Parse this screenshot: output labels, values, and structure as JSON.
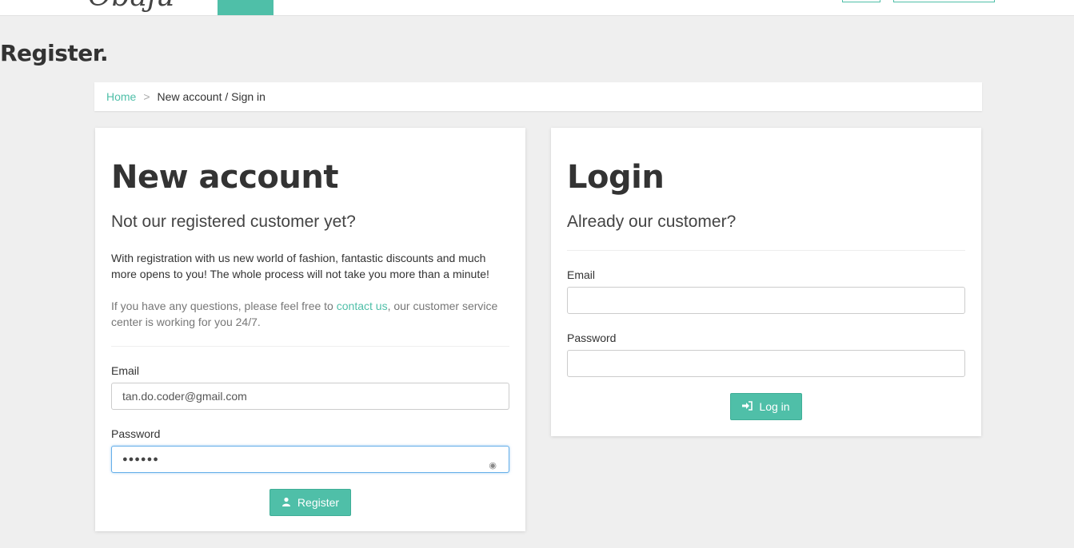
{
  "header": {
    "logo_text": "Obaju"
  },
  "page_title": "Register.",
  "breadcrumb": {
    "home": "Home",
    "separator": ">",
    "current": "New account / Sign in"
  },
  "register": {
    "title": "New account",
    "lead": "Not our registered customer yet?",
    "text1": "With registration with us new world of fashion, fantastic discounts and much more opens to you! The whole process will not take you more than a minute!",
    "text2_before": "If you have any questions, please feel free to ",
    "text2_link": "contact us",
    "text2_after": ", our customer service center is working for you 24/7.",
    "email_label": "Email",
    "email_value": "tan.do.coder@gmail.com",
    "password_label": "Password",
    "password_value": "●●●●●●",
    "button": "Register",
    "button_icon": "user-icon"
  },
  "login": {
    "title": "Login",
    "lead": "Already our customer?",
    "email_label": "Email",
    "email_value": "",
    "password_label": "Password",
    "password_value": "",
    "button": "Log in",
    "button_icon": "sign-in-icon"
  },
  "colors": {
    "accent": "#4fbfa8",
    "background": "#efefef"
  }
}
